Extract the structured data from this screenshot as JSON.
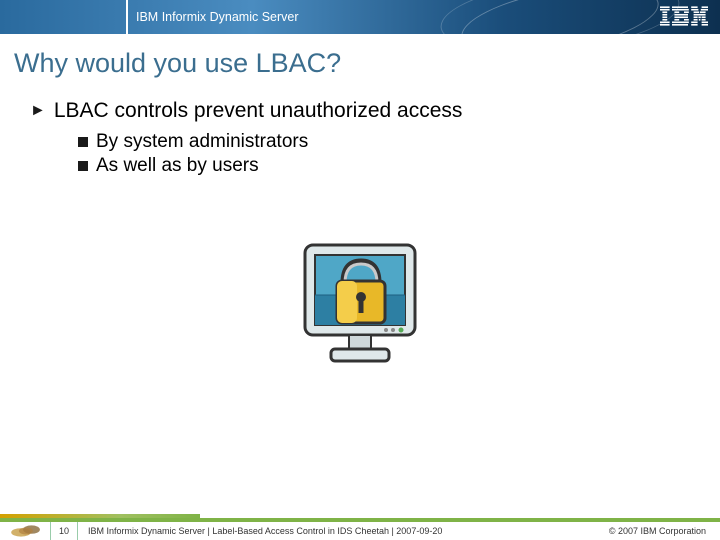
{
  "header": {
    "title": "IBM Informix Dynamic Server",
    "logo": "IBM"
  },
  "slide_title": "Why would you use LBAC?",
  "bullets": {
    "main": "LBAC controls prevent unauthorized access",
    "subs": [
      "By system administrators",
      "As well as by users"
    ]
  },
  "image": {
    "alt": "monitor-with-padlock-icon"
  },
  "footer": {
    "page_number": "10",
    "text": "IBM Informix Dynamic Server  |  Label-Based Access Control in IDS Cheetah | 2007-09-20",
    "copyright": "© 2007 IBM Corporation"
  }
}
